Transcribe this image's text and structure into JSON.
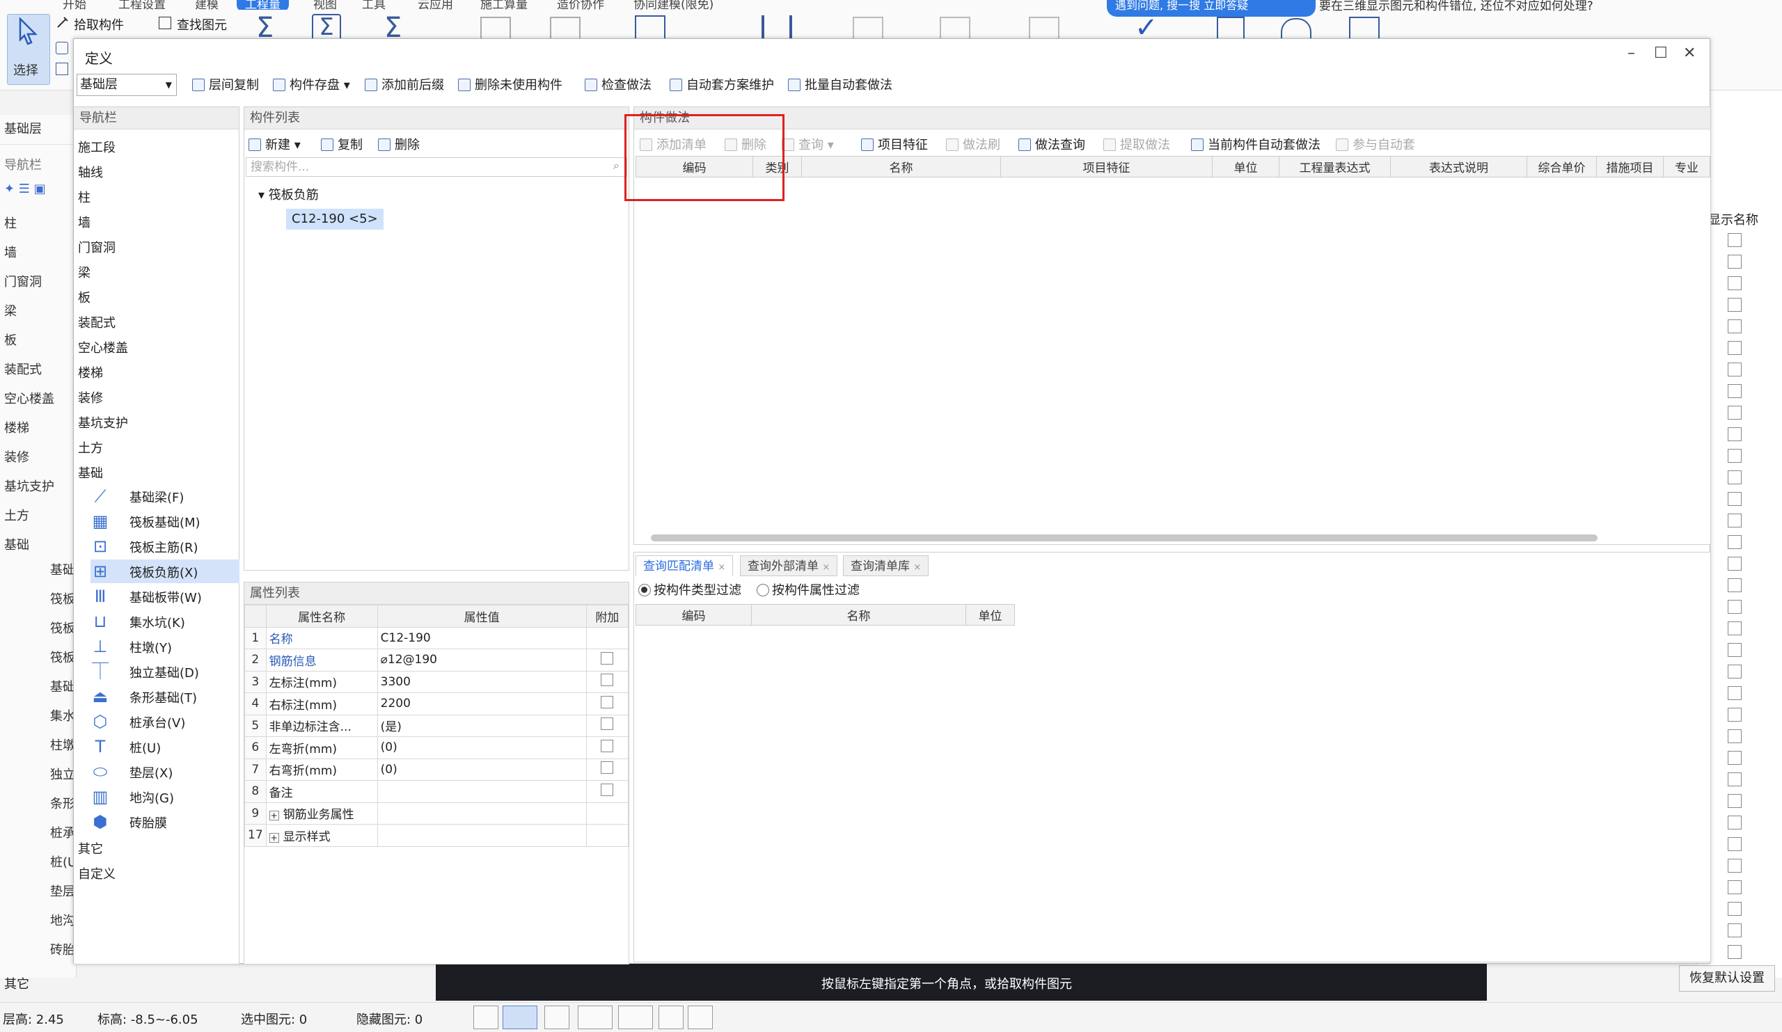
{
  "ribbon": {
    "menu_tabs": [
      "开始",
      "工程设置",
      "建模",
      "工程量",
      "视图",
      "工具",
      "云应用",
      "施工算量",
      "造价协作",
      "协同建模(限免)"
    ],
    "active_tab": "工程量",
    "select_label": "选择",
    "pick_component": "拾取构件",
    "find_element": "查找图元",
    "notice_pill": "遇到问题, 搜一搜   立即答疑",
    "right_notice": "要在三维显示图元和构件错位, 还位不对应如何处理?"
  },
  "app_left": {
    "layer_tab": "基础层",
    "nav_label": "导航栏",
    "items": [
      "柱",
      "墙",
      "门窗洞",
      "梁",
      "板",
      "装配式",
      "空心楼盖",
      "楼梯",
      "装修",
      "基坑支护",
      "土方",
      "基础"
    ],
    "sub_items": [
      "基础",
      "筏板",
      "筏板",
      "筏板",
      "基础",
      "集水",
      "柱墩",
      "独立",
      "条形",
      "桩承",
      "桩(U",
      "垫层",
      "地沟",
      "砖胎"
    ],
    "other": "其它"
  },
  "app_right": {
    "show_name": "显示名称",
    "restore_default": "恢复默认设置"
  },
  "canvas_hint": "按鼠标左键指定第一个角点，或拾取构件图元",
  "statusbar": {
    "floor_height": "层高:   2.45",
    "elevation": "标高:   -8.5~-6.05",
    "selected": "选中图元:  0",
    "hidden": "隐藏图元:  0"
  },
  "dialog": {
    "title": "定义",
    "floor": "基础层",
    "toolbar": [
      "层间复制",
      "构件存盘",
      "添加前后缀",
      "删除未使用构件",
      "检查做法",
      "自动套方案维护",
      "批量自动套做法"
    ],
    "nav": {
      "title": "导航栏",
      "items": [
        "施工段",
        "轴线",
        "柱",
        "墙",
        "门窗洞",
        "梁",
        "板",
        "装配式",
        "空心楼盖",
        "楼梯",
        "装修",
        "基坑支护",
        "土方",
        "基础"
      ],
      "foundation_children": [
        {
          "label": "基础梁(F)",
          "icon": "foundation-beam-icon"
        },
        {
          "label": "筏板基础(M)",
          "icon": "raft-foundation-icon"
        },
        {
          "label": "筏板主筋(R)",
          "icon": "raft-main-rebar-icon"
        },
        {
          "label": "筏板负筋(X)",
          "icon": "raft-negative-rebar-icon"
        },
        {
          "label": "基础板带(W)",
          "icon": "foundation-strip-icon"
        },
        {
          "label": "集水坑(K)",
          "icon": "sump-pit-icon"
        },
        {
          "label": "柱墩(Y)",
          "icon": "column-pier-icon"
        },
        {
          "label": "独立基础(D)",
          "icon": "isolated-foundation-icon"
        },
        {
          "label": "条形基础(T)",
          "icon": "strip-foundation-icon"
        },
        {
          "label": "桩承台(V)",
          "icon": "pile-cap-icon"
        },
        {
          "label": "桩(U)",
          "icon": "pile-icon"
        },
        {
          "label": "垫层(X)",
          "icon": "cushion-icon"
        },
        {
          "label": "地沟(G)",
          "icon": "trench-icon"
        },
        {
          "label": "砖胎膜",
          "icon": "brick-mold-icon"
        }
      ],
      "after": [
        "其它",
        "自定义"
      ]
    },
    "complist": {
      "title": "构件列表",
      "new": "新建",
      "copy": "复制",
      "delete": "删除",
      "search_placeholder": "搜索构件...",
      "root": "筏板负筋",
      "item": "C12-190 <5>"
    },
    "props": {
      "title": "属性列表",
      "headers": [
        "属性名称",
        "属性值",
        "附加"
      ],
      "rows": [
        {
          "n": "1",
          "name": "名称",
          "value": "C12-190",
          "blue": true,
          "cb": false
        },
        {
          "n": "2",
          "name": "钢筋信息",
          "value": "⌀12@190",
          "blue": true,
          "cb": true
        },
        {
          "n": "3",
          "name": "左标注(mm)",
          "value": "3300",
          "blue": false,
          "cb": true
        },
        {
          "n": "4",
          "name": "右标注(mm)",
          "value": "2200",
          "blue": false,
          "cb": true
        },
        {
          "n": "5",
          "name": "非单边标注含...",
          "value": "(是)",
          "blue": false,
          "cb": true
        },
        {
          "n": "6",
          "name": "左弯折(mm)",
          "value": "(0)",
          "blue": false,
          "cb": true
        },
        {
          "n": "7",
          "name": "右弯折(mm)",
          "value": "(0)",
          "blue": false,
          "cb": true
        },
        {
          "n": "8",
          "name": "备注",
          "value": "",
          "blue": false,
          "cb": true
        },
        {
          "n": "9",
          "name": "钢筋业务属性",
          "value": "",
          "blue": false,
          "cb": false,
          "expand": true
        },
        {
          "n": "17",
          "name": "显示样式",
          "value": "",
          "blue": false,
          "cb": false,
          "expand": true
        }
      ]
    },
    "method": {
      "title": "构件做法",
      "toolbar": [
        "添加清单",
        "删除",
        "查询",
        "项目特征",
        "做法刷",
        "做法查询",
        "提取做法",
        "当前构件自动套做法",
        "参与自动套"
      ],
      "headers": [
        "编码",
        "类别",
        "名称",
        "项目特征",
        "单位",
        "工程量表达式",
        "表达式说明",
        "综合单价",
        "措施项目",
        "专业"
      ]
    },
    "query": {
      "tabs": [
        "查询匹配清单",
        "查询外部清单",
        "查询清单库"
      ],
      "filter_type": "按构件类型过滤",
      "filter_attr": "按构件属性过滤",
      "headers": [
        "编码",
        "名称",
        "单位"
      ]
    }
  }
}
